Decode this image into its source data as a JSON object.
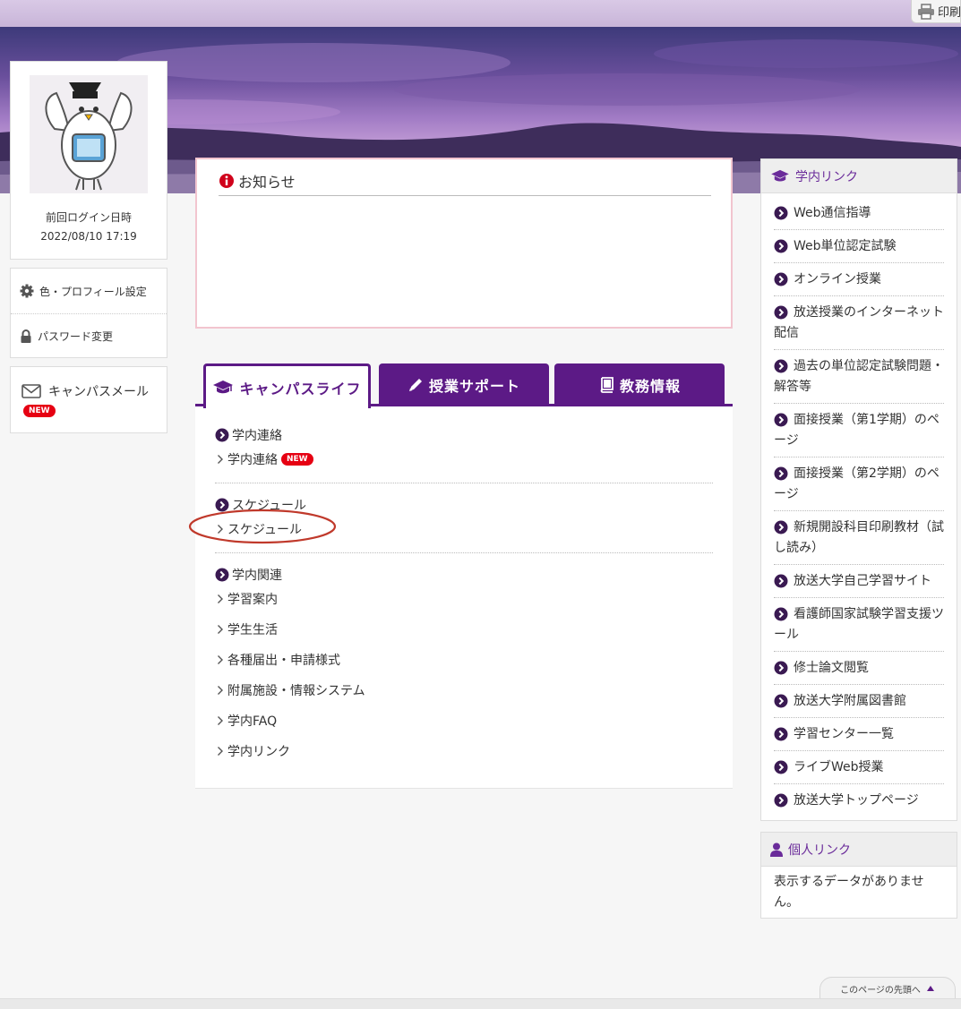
{
  "header": {
    "print_label": "印刷"
  },
  "profile": {
    "last_login_label": "前回ログイン日時",
    "last_login_date": "2022/08/10 17:19"
  },
  "settings": {
    "color_profile": "色・プロフィール設定",
    "password": "パスワード変更"
  },
  "mail": {
    "label": "キャンパスメール",
    "badge": "NEW"
  },
  "notice": {
    "title": "お知らせ"
  },
  "tabs": [
    {
      "label": "キャンパスライフ"
    },
    {
      "label": "授業サポート"
    },
    {
      "label": "教務情報"
    }
  ],
  "campus_life": {
    "sections": [
      {
        "title": "学内連絡",
        "items": [
          {
            "label": "学内連絡",
            "badge": "NEW"
          }
        ]
      },
      {
        "title": "スケジュール",
        "items": [
          {
            "label": "スケジュール"
          }
        ]
      },
      {
        "title": "学内関連",
        "items": [
          {
            "label": "学習案内"
          },
          {
            "label": "学生生活"
          },
          {
            "label": "各種届出・申請様式"
          },
          {
            "label": "附属施設・情報システム"
          },
          {
            "label": "学内FAQ"
          },
          {
            "label": "学内リンク"
          }
        ]
      }
    ]
  },
  "campus_links": {
    "title": "学内リンク",
    "items": [
      "Web通信指導",
      "Web単位認定試験",
      "オンライン授業",
      "放送授業のインターネット配信",
      "過去の単位認定試験問題・解答等",
      "面接授業（第1学期）のページ",
      "面接授業（第2学期）のページ",
      "新規開設科目印刷教材（試し読み）",
      "放送大学自己学習サイト",
      "看護師国家試験学習支援ツール",
      "修士論文閲覧",
      "放送大学附属図書館",
      "学習センター一覧",
      "ライブWeb授業",
      "放送大学トップページ"
    ]
  },
  "personal_links": {
    "title": "個人リンク",
    "empty_message": "表示するデータがありません。"
  },
  "footer": {
    "page_top": "このページの先頭へ"
  },
  "colors": {
    "accent": "#5c1a86",
    "link_head": "#6a2b9a",
    "badge": "#e60012",
    "notice_border": "#f2c5cf"
  }
}
